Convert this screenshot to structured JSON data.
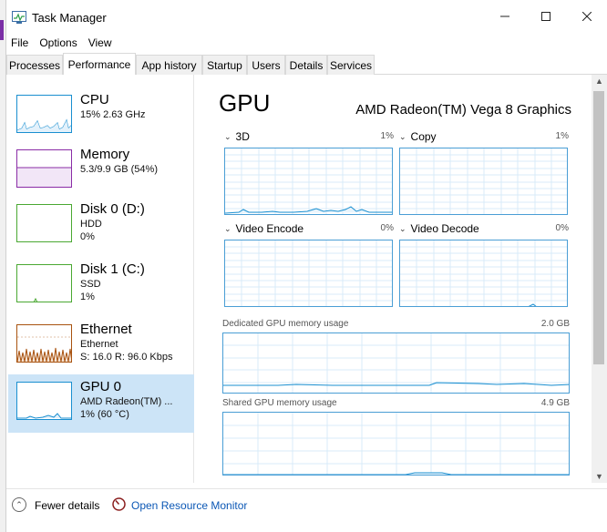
{
  "window": {
    "title": "Task Manager",
    "app_icon": "task-manager-icon"
  },
  "menu": [
    "File",
    "Options",
    "View"
  ],
  "tabs": [
    {
      "label": "Processes",
      "active": false
    },
    {
      "label": "Performance",
      "active": true
    },
    {
      "label": "App history",
      "active": false
    },
    {
      "label": "Startup",
      "active": false
    },
    {
      "label": "Users",
      "active": false
    },
    {
      "label": "Details",
      "active": false
    },
    {
      "label": "Services",
      "active": false
    }
  ],
  "sidebar": {
    "items": [
      {
        "name": "CPU",
        "line1": "15% 2.63 GHz",
        "line2": "",
        "color": "#1a8fd0"
      },
      {
        "name": "Memory",
        "line1": "5.3/9.9 GB (54%)",
        "line2": "",
        "color": "#8a2ca6"
      },
      {
        "name": "Disk 0 (D:)",
        "line1": "HDD",
        "line2": "0%",
        "color": "#4aa832"
      },
      {
        "name": "Disk 1 (C:)",
        "line1": "SSD",
        "line2": "1%",
        "color": "#4aa832"
      },
      {
        "name": "Ethernet",
        "line1": "Ethernet",
        "line2": "S: 16.0  R: 96.0 Kbps",
        "color": "#a8520f"
      },
      {
        "name": "GPU 0",
        "line1": "AMD Radeon(TM) ...",
        "line2": "1% (60 °C)",
        "color": "#1a8fd0",
        "selected": true
      }
    ]
  },
  "main": {
    "title": "GPU",
    "model": "AMD Radeon(TM) Vega 8 Graphics",
    "engines": [
      {
        "label": "3D",
        "pct": "1%"
      },
      {
        "label": "Copy",
        "pct": "1%"
      },
      {
        "label": "Video Encode",
        "pct": "0%"
      },
      {
        "label": "Video Decode",
        "pct": "0%"
      }
    ],
    "memory": [
      {
        "label": "Dedicated GPU memory usage",
        "value": "2.0 GB"
      },
      {
        "label": "Shared GPU memory usage",
        "value": "4.9 GB"
      }
    ]
  },
  "footer": {
    "fewer_details": "Fewer details",
    "open_resource_monitor": "Open Resource Monitor"
  },
  "colors": {
    "accent_blue": "#1a8fd0",
    "graph_border": "#4a9ed5",
    "grid": "#d8ebf8",
    "link": "#0b57b5",
    "selected_bg": "#cce4f7"
  }
}
